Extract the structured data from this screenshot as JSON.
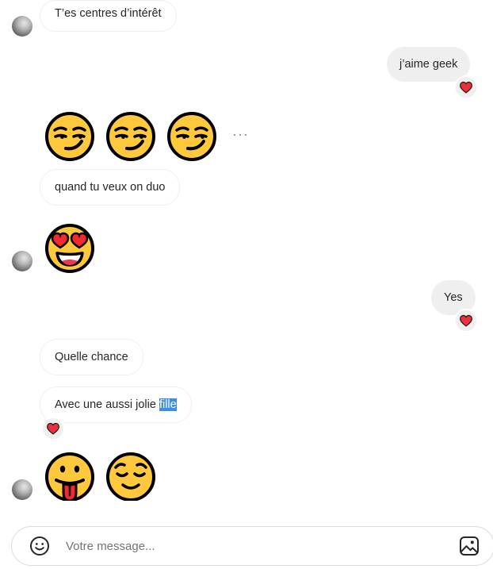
{
  "messages": {
    "m1": "T’es centres d’intérêt",
    "m2": "j’aime geek",
    "m4": "quand tu veux on duo",
    "m6": "Yes",
    "m7": "Quelle chance",
    "m8_prefix": "Avec une aussi jolie ",
    "m8_highlight": "fille"
  },
  "emojis": {
    "smirk": "smirking-face",
    "heart_eyes": "heart-eyes-face",
    "tongue": "tongue-out-face",
    "relieved": "relieved-face"
  },
  "more_options": "···",
  "reaction": "heart",
  "composer": {
    "placeholder": "Votre message..."
  },
  "colors": {
    "heart": "#ed2f3a",
    "emoji_yellow": "#ffc83d",
    "selection": "#3d8fe0"
  }
}
